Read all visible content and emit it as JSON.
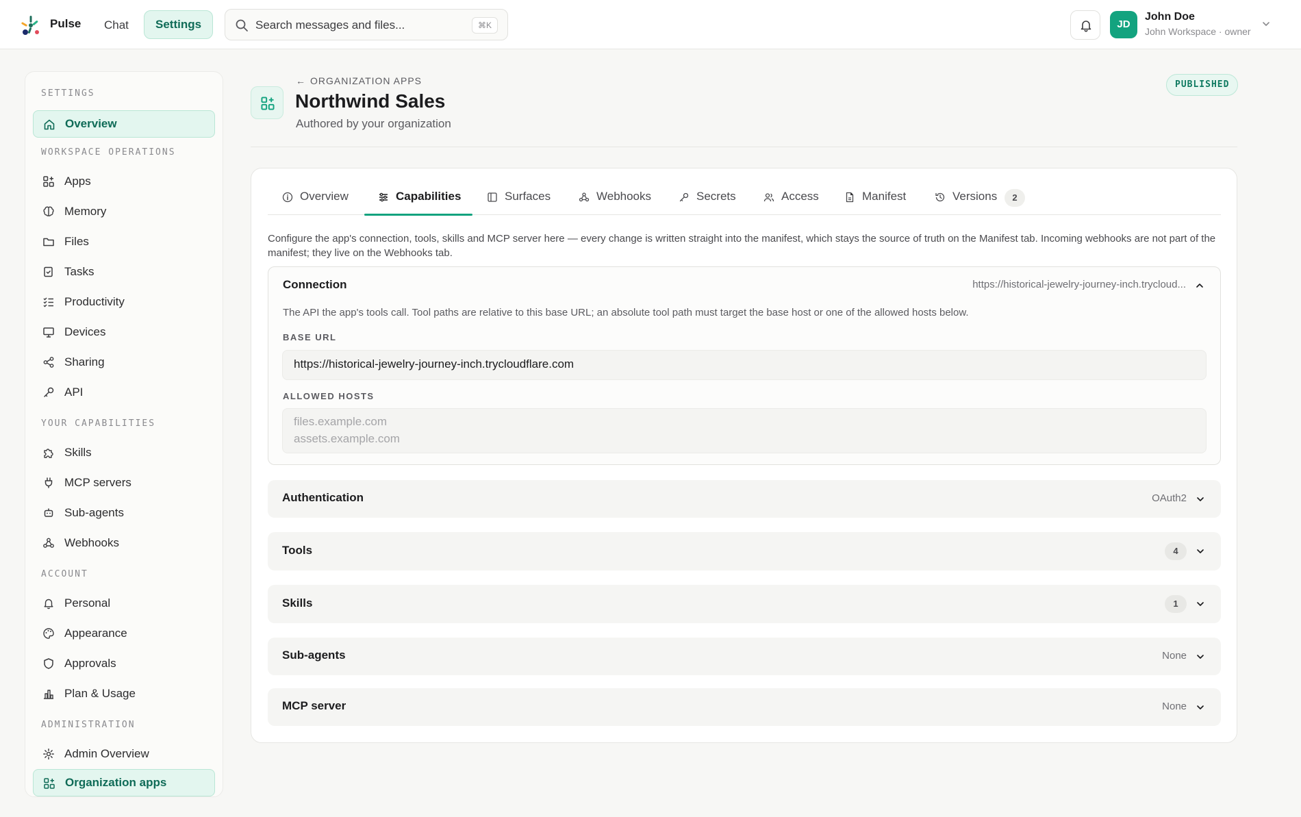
{
  "topbar": {
    "app_name": "Pulse",
    "nav_chat": "Chat",
    "nav_settings": "Settings",
    "search_placeholder": "Search messages and files...",
    "search_shortcut": "⌘K",
    "user": {
      "initials": "JD",
      "name": "John Doe",
      "subtitle": "John Workspace · owner"
    }
  },
  "sidebar": {
    "sections": {
      "settings": "SETTINGS",
      "workspace_operations": "WORKSPACE OPERATIONS",
      "your_capabilities": "YOUR CAPABILITIES",
      "account": "ACCOUNT",
      "administration": "ADMINISTRATION"
    },
    "items": {
      "overview": "Overview",
      "apps": "Apps",
      "memory": "Memory",
      "files": "Files",
      "tasks": "Tasks",
      "productivity": "Productivity",
      "devices": "Devices",
      "sharing": "Sharing",
      "api": "API",
      "skills": "Skills",
      "mcp_servers": "MCP servers",
      "sub_agents": "Sub-agents",
      "webhooks": "Webhooks",
      "personal": "Personal",
      "appearance": "Appearance",
      "approvals": "Approvals",
      "plan_usage": "Plan & Usage",
      "admin_overview": "Admin Overview",
      "organization_apps": "Organization apps"
    }
  },
  "header": {
    "breadcrumb": "ORGANIZATION APPS",
    "title": "Northwind Sales",
    "subtitle": "Authored by your organization",
    "status": "PUBLISHED"
  },
  "tabs": {
    "overview": "Overview",
    "capabilities": "Capabilities",
    "surfaces": "Surfaces",
    "webhooks": "Webhooks",
    "secrets": "Secrets",
    "access": "Access",
    "manifest": "Manifest",
    "versions": "Versions",
    "versions_count": "2"
  },
  "intro": "Configure the app's connection, tools, skills and MCP server here — every change is written straight into the manifest, which stays the source of truth on the Manifest tab. Incoming webhooks are not part of the manifest; they live on the Webhooks tab.",
  "connection": {
    "title": "Connection",
    "summary": "https://historical-jewelry-journey-inch.trycloud...",
    "description": "The API the app's tools call. Tool paths are relative to this base URL; an absolute tool path must target the base host or one of the allowed hosts below.",
    "base_url_label": "BASE URL",
    "base_url_value": "https://historical-jewelry-journey-inch.trycloudflare.com",
    "allowed_hosts_label": "ALLOWED HOSTS",
    "allowed_hosts_placeholder_1": "files.example.com",
    "allowed_hosts_placeholder_2": "assets.example.com"
  },
  "sections": {
    "authentication": {
      "title": "Authentication",
      "meta": "OAuth2"
    },
    "tools": {
      "title": "Tools",
      "count": "4"
    },
    "skills": {
      "title": "Skills",
      "count": "1"
    },
    "sub_agents": {
      "title": "Sub-agents",
      "meta": "None"
    },
    "mcp_server": {
      "title": "MCP server",
      "meta": "None"
    }
  },
  "colors": {
    "accent": "#13a37f",
    "accent_dark": "#0f6b57",
    "accent_bg": "#e3f6ef"
  }
}
